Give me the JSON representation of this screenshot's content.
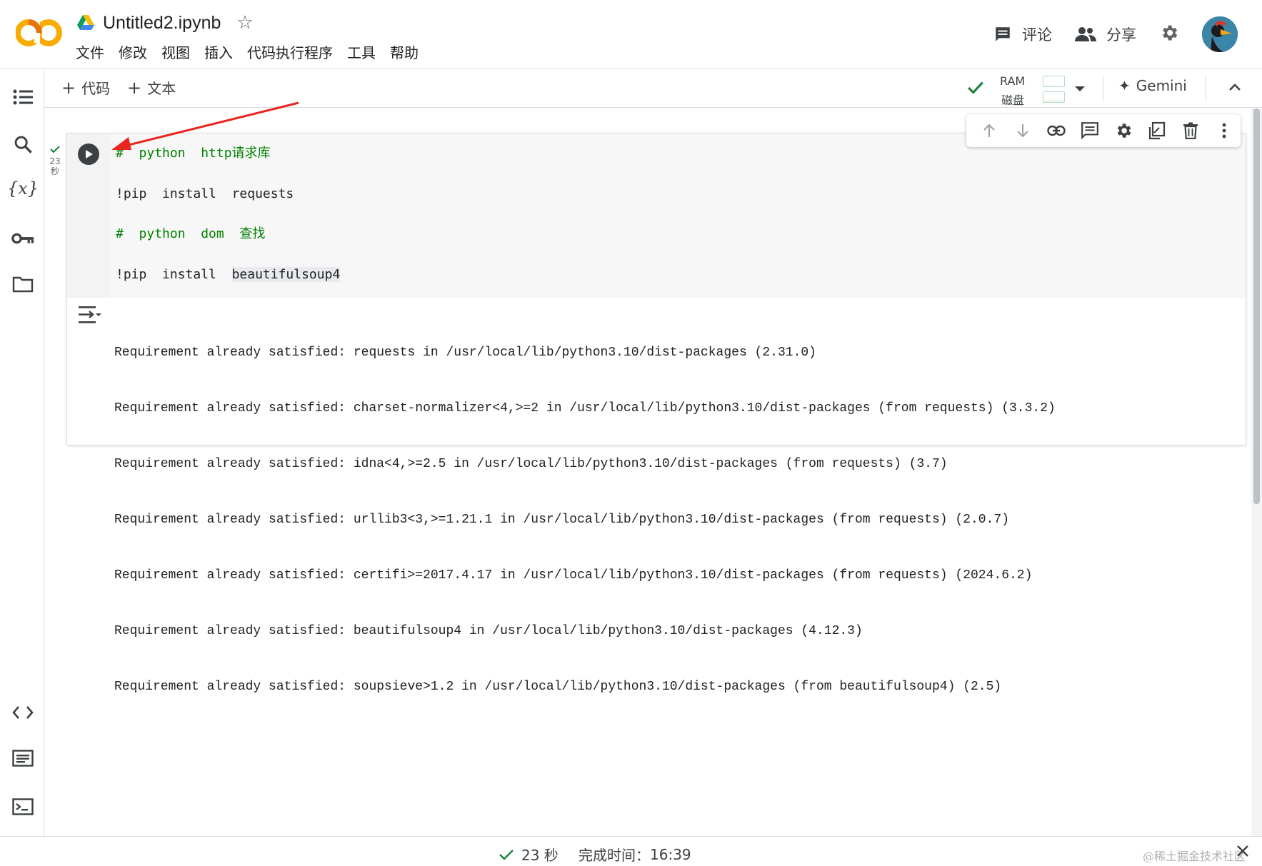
{
  "app": {
    "logo_text": "CO",
    "doc_title": "Untitled2.ipynb"
  },
  "menu": [
    "文件",
    "修改",
    "视图",
    "插入",
    "代码执行程序",
    "工具",
    "帮助"
  ],
  "header_actions": {
    "comment_label": "评论",
    "share_label": "分享"
  },
  "toolbar": {
    "add_code_label": "代码",
    "add_text_label": "文本",
    "ram_label": "RAM",
    "disk_label": "磁盘",
    "ram_usage": 0.08,
    "disk_usage": 0.2,
    "gemini_label": "Gemini"
  },
  "cell": {
    "exec_time_value": "23",
    "exec_time_unit": "秒",
    "code_lines": [
      {
        "prefix": "#",
        "text": "  python  http请求库",
        "kind": "comment"
      },
      {
        "prefix": "",
        "text": "!pip  install  requests",
        "kind": "normal"
      },
      {
        "prefix": "#",
        "text": "  python  dom  查找",
        "kind": "comment"
      },
      {
        "prefix": "",
        "text": "!pip  install  ",
        "highlight": "beautifulsoup4",
        "kind": "normal"
      }
    ],
    "output_lines": [
      "Requirement already satisfied: requests in /usr/local/lib/python3.10/dist-packages (2.31.0)",
      "Requirement already satisfied: charset-normalizer<4,>=2 in /usr/local/lib/python3.10/dist-packages (from requests) (3.3.2)",
      "Requirement already satisfied: idna<4,>=2.5 in /usr/local/lib/python3.10/dist-packages (from requests) (3.7)",
      "Requirement already satisfied: urllib3<3,>=1.21.1 in /usr/local/lib/python3.10/dist-packages (from requests) (2.0.7)",
      "Requirement already satisfied: certifi>=2017.4.17 in /usr/local/lib/python3.10/dist-packages (from requests) (2024.6.2)",
      "Requirement already satisfied: beautifulsoup4 in /usr/local/lib/python3.10/dist-packages (4.12.3)",
      "Requirement already satisfied: soupsieve>1.2 in /usr/local/lib/python3.10/dist-packages (from beautifulsoup4) (2.5)"
    ]
  },
  "status": {
    "duration": "23 秒",
    "finished_label": "完成时间：",
    "finished_time": "16:39"
  },
  "watermark": "@稀土掘金技术社区",
  "colors": {
    "accent_orange": "#f9ab00",
    "success_green": "#188038",
    "comment_green": "#008000",
    "annotation_red": "#e8251f"
  }
}
